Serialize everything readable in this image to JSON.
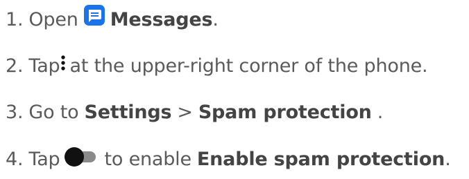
{
  "steps": [
    {
      "number": "1.",
      "text_before": "Open",
      "app_name": "Messages",
      "text_after": ".",
      "icon": "messages-app-icon"
    },
    {
      "number": "2.",
      "text_before": "Tap",
      "text_after": "at the upper-right corner of the phone.",
      "icon": "more-options-icon"
    },
    {
      "number": "3.",
      "text_before": "Go to",
      "settings_label": "Settings",
      "separator": ">",
      "spam_label": "Spam protection",
      "text_after": "."
    },
    {
      "number": "4.",
      "text_before": "Tap",
      "text_middle": "to enable",
      "option_label": "Enable spam protection",
      "text_after": ".",
      "icon": "toggle-switch-icon"
    }
  ],
  "colors": {
    "text": "#5a5a5a",
    "bold_text": "#444444",
    "messages_icon": "#1a73e8",
    "toggle_track": "#8a8a8a",
    "toggle_knob": "#111111"
  }
}
